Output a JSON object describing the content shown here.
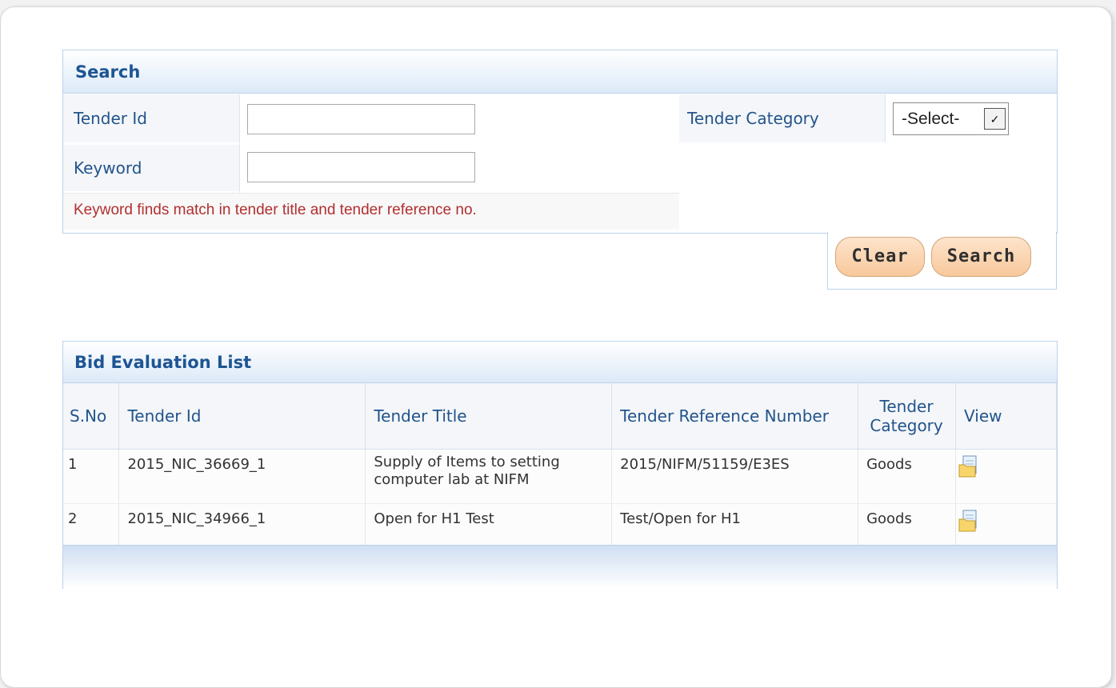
{
  "search": {
    "title": "Search",
    "tender_id_label": "Tender Id",
    "tender_id_value": "",
    "keyword_label": "Keyword",
    "keyword_value": "",
    "tender_category_label": "Tender Category",
    "tender_category_selected": "-Select-",
    "hint": "Keyword finds match in tender title and tender reference no.",
    "clear_label": "Clear",
    "search_label": "Search"
  },
  "bid_list": {
    "title": "Bid Evaluation List",
    "columns": [
      "S.No",
      "Tender Id",
      "Tender Title",
      "Tender Reference Number",
      "Tender Category",
      "View"
    ],
    "rows": [
      {
        "sno": "1",
        "tender_id": "2015_NIC_36669_1",
        "title": "Supply of Items to setting computer lab at NIFM",
        "ref": "2015/NIFM/51159/E3ES",
        "category": "Goods",
        "view_icon": "view-document-icon"
      },
      {
        "sno": "2",
        "tender_id": "2015_NIC_34966_1",
        "title": "Open for H1 Test",
        "ref": "Test/Open for H1",
        "category": "Goods",
        "view_icon": "view-document-icon"
      }
    ]
  },
  "colors": {
    "header_text": "#1d5593",
    "label_text": "#22548b",
    "hint_text": "#b22f2f",
    "button_fill": "#f7c89b"
  }
}
